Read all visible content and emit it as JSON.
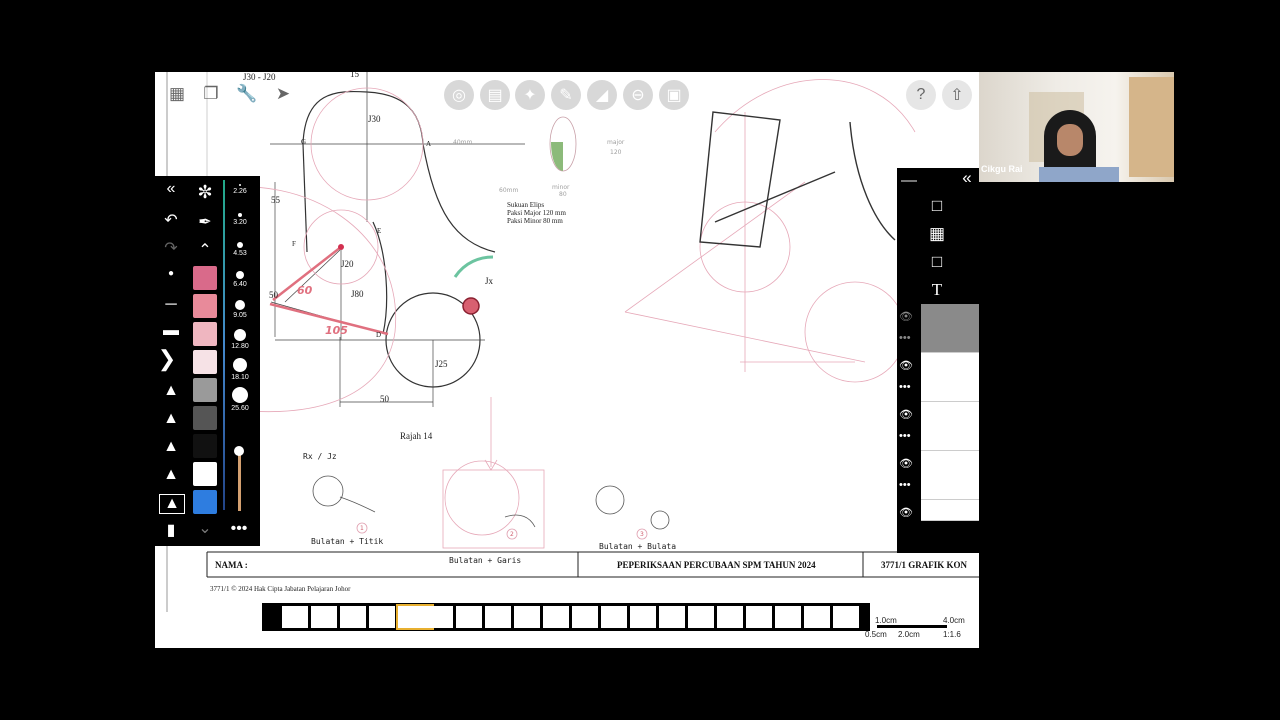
{
  "app": {
    "top_icons": [
      "grid-icon",
      "layers-icon",
      "wrench-icon",
      "pen-selection-icon"
    ],
    "tools": [
      "guides-icon",
      "perspective-icon",
      "symmetry-icon",
      "ruler-icon",
      "protractor-icon",
      "ellipse-icon",
      "stamp-icon"
    ],
    "help_label": "?",
    "share_icon": "share-icon"
  },
  "brush_sizes": [
    "2.26",
    "3.20",
    "4.53",
    "6.40",
    "9.05",
    "12.80",
    "18.10",
    "25.60"
  ],
  "swatches": [
    "#d96a8a",
    "#e88a9a",
    "#efb6c0",
    "#f6e2e6",
    "#9a9a9a",
    "#555555",
    "#111111",
    "#ffffff",
    "#2e7de0"
  ],
  "drawing": {
    "labels": {
      "j30_top": "J30 - J20",
      "j30": "J30",
      "j20": "J20",
      "j80": "J80",
      "j25": "J25",
      "jx": "Jx",
      "d55": "55",
      "d50_left": "50",
      "d50_bottom": "50",
      "d15": "15",
      "pt_g": "G",
      "pt_a": "A",
      "pt_e": "E",
      "pt_f": "F",
      "pt_d": "D",
      "ellipse_title": "Sukuan Elips",
      "ellipse_major": "Paksi Major 120 mm",
      "ellipse_minor": "Paksi Minor 80 mm",
      "caption": "Rajah 14",
      "hand_60": "60",
      "hand_105": "105",
      "rx_jz": "Rx / Jz",
      "bulatan_titik": "Bulatan + Titik",
      "bulatan_garis": "Bulatan + Garis",
      "bulatan_bulatan": "Bulatan + Bulata",
      "n1": "1",
      "n2": "2",
      "n3": "3",
      "minor": "minor",
      "major": "major",
      "num_40": "40mm",
      "num_60": "60mm",
      "num_80": "80",
      "num_120": "120"
    },
    "footer": {
      "nama": "NAMA :",
      "exam_title": "PEPERIKSAAN PERCUBAAN SPM  TAHUN 2024",
      "paper_code": "3771/1  GRAFIK KON",
      "copyright": "3771/1 © 2024 Hak Cipta Jabatan Pelajaran Johor"
    }
  },
  "scale": {
    "s1": "1.0cm",
    "s2": "4.0cm",
    "s3": "0.5cm",
    "s4": "2.0cm",
    "ratio": "1:1.6"
  },
  "webcam": {
    "name": "Cikgu Rai"
  }
}
